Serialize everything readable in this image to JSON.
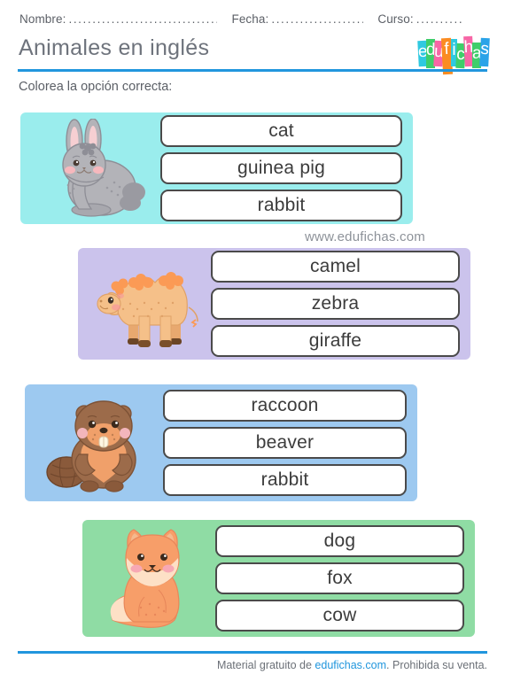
{
  "header": {
    "fields": [
      {
        "label": "Nombre:",
        "dots": "................................"
      },
      {
        "label": "Fecha:",
        "dots": "...................."
      },
      {
        "label": "Curso:",
        "dots": ".........."
      }
    ],
    "title": "Animales en inglés",
    "logo": {
      "text": "edufichas",
      "letters": [
        {
          "char": "e",
          "color": "#2fc9e0"
        },
        {
          "char": "d",
          "color": "#3ece6a"
        },
        {
          "char": "u",
          "color": "#f766a6"
        },
        {
          "char": "f",
          "color": "#fb8c22"
        },
        {
          "char": "i",
          "color": "#2fc9e0"
        },
        {
          "char": "c",
          "color": "#3ece6a"
        },
        {
          "char": "h",
          "color": "#f766a6"
        },
        {
          "char": "a",
          "color": "#3ece6a"
        },
        {
          "char": "s",
          "color": "#2aa3e8"
        }
      ]
    },
    "rule_color": "#2196dd"
  },
  "instruction": "Colorea la opción correcta:",
  "watermark": "www.edufichas.com",
  "cards": [
    {
      "animal": "rabbit",
      "background": "#9aeded",
      "options": [
        "cat",
        "guinea pig",
        "rabbit"
      ]
    },
    {
      "animal": "camel",
      "background": "#cbc3ec",
      "options": [
        "camel",
        "zebra",
        "giraffe"
      ]
    },
    {
      "animal": "beaver",
      "background": "#9dc9f0",
      "options": [
        "raccoon",
        "beaver",
        "rabbit"
      ]
    },
    {
      "animal": "fox",
      "background": "#8fdca4",
      "options": [
        "dog",
        "fox",
        "cow"
      ]
    }
  ],
  "footer": {
    "prefix": "Material gratuito de ",
    "link": "edufichas.com",
    "suffix": ". Prohibida su venta.",
    "link_color": "#2196dd"
  }
}
